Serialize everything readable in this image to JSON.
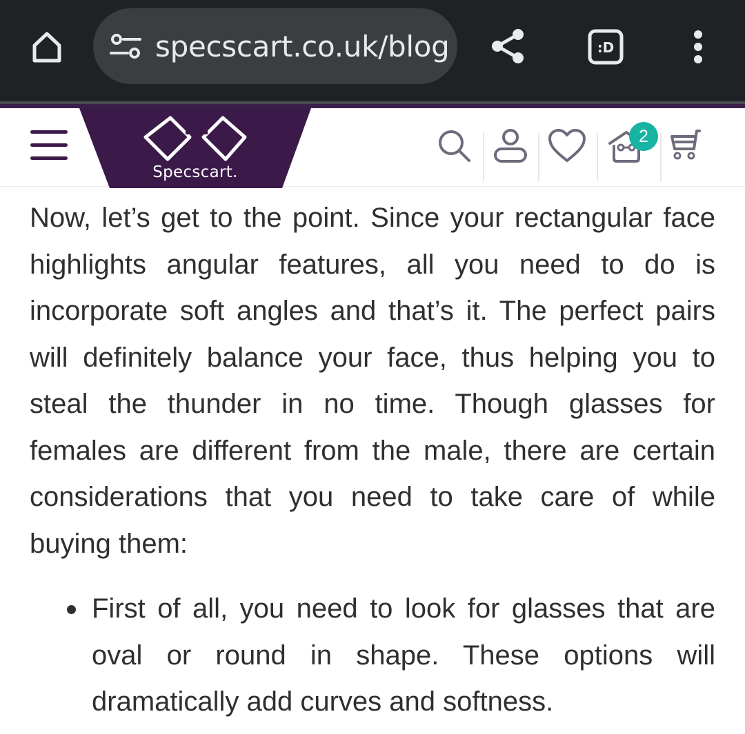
{
  "browser": {
    "url": "specscart.co.uk/blog",
    "home_icon": "home-icon",
    "site_settings_icon": "tune-icon",
    "share_icon": "share-icon",
    "tab_switcher_label": ":D",
    "menu_icon": "more-vertical-icon"
  },
  "header": {
    "brand_name": "Specscart.",
    "brand_color": "#3b1a4a",
    "menu_icon": "hamburger-icon",
    "icons": [
      "search-icon",
      "user-icon",
      "heart-icon",
      "try-on-icon",
      "cart-icon"
    ],
    "try_on_count": "2",
    "badge_color": "#17b3a3"
  },
  "article": {
    "paragraph": "Now, let’s get to the point. Since your rectangular face highlights angular features, all you need to do is incorporate soft angles and that’s it. The perfect pairs will definitely balance your face, thus helping you to steal the thunder in no time. Though glasses for females are different from the male, there are certain considerations that you need to take care of while buying them:",
    "bullets": [
      "First of all, you need to look for glasses that are oval or round in shape. These options will dramatically add curves and softness."
    ]
  }
}
